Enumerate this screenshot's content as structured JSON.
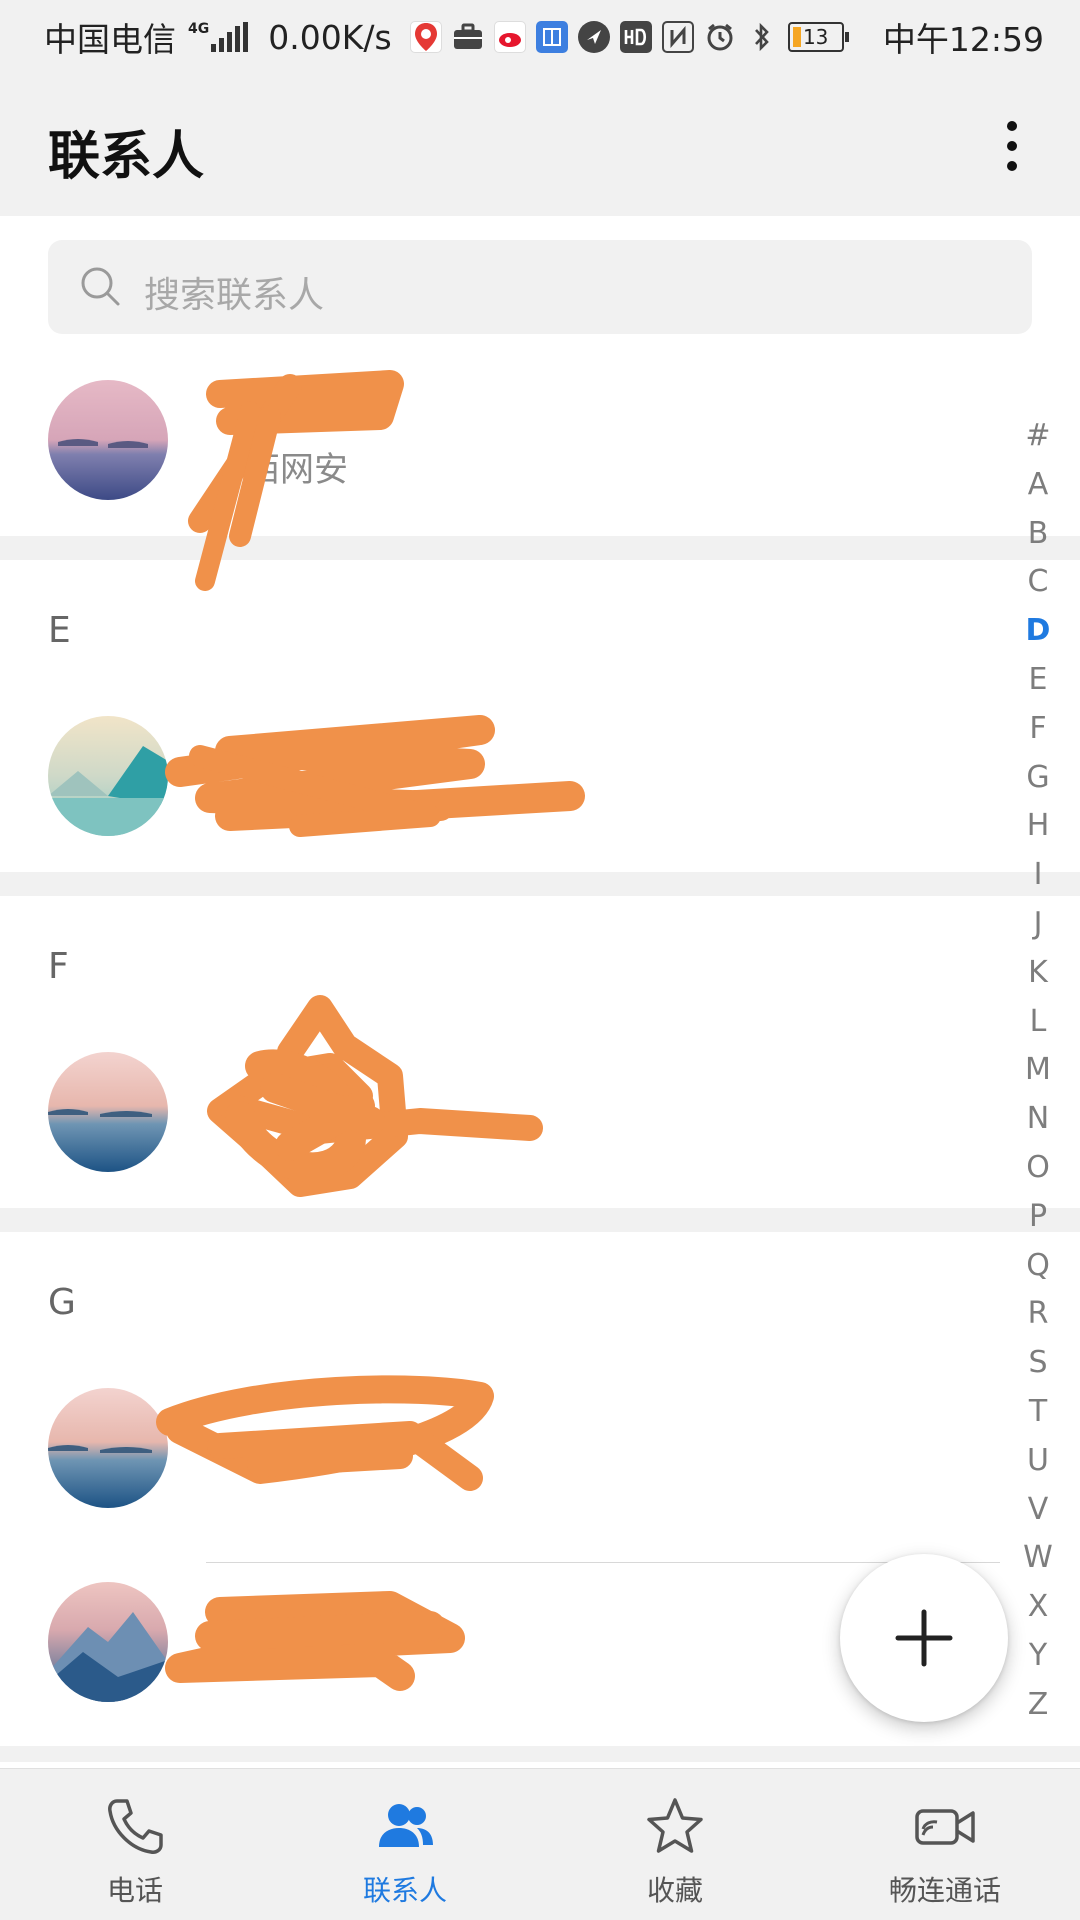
{
  "status_bar": {
    "carrier": "中国电信",
    "network": "4G",
    "speed": "0.00K/s",
    "battery": "13",
    "time": "中午12:59",
    "icons": [
      "baidu-map-icon",
      "briefcase-icon",
      "sina-icon",
      "tieba-icon",
      "bird-app-icon",
      "hd-icon",
      "nfc-icon",
      "alarm-icon",
      "bluetooth-icon",
      "battery-icon"
    ]
  },
  "header": {
    "title": "联系人",
    "more_icon": "more-vertical-icon"
  },
  "search": {
    "placeholder": "搜索联系人",
    "icon": "search-icon"
  },
  "contacts": {
    "row1": {
      "name": "",
      "sub": "西网安",
      "redacted": true
    },
    "section_e": {
      "letter": "E",
      "row1": {
        "name": "",
        "sub": "",
        "redacted": true
      }
    },
    "section_f": {
      "letter": "F",
      "row1": {
        "name": "",
        "sub": "",
        "redacted": true
      }
    },
    "section_g": {
      "letter": "G",
      "row1": {
        "name": "",
        "sub": "",
        "redacted": true
      },
      "row2": {
        "name": "",
        "sub": "",
        "redacted": true
      }
    }
  },
  "alpha_index": {
    "letters": [
      "#",
      "A",
      "B",
      "C",
      "D",
      "E",
      "F",
      "G",
      "H",
      "I",
      "J",
      "K",
      "L",
      "M",
      "N",
      "O",
      "P",
      "Q",
      "R",
      "S",
      "T",
      "U",
      "V",
      "W",
      "X",
      "Y",
      "Z"
    ],
    "active": "D"
  },
  "fab": {
    "icon": "plus-icon"
  },
  "bottom_nav": {
    "items": [
      {
        "label": "电话",
        "icon": "phone-icon"
      },
      {
        "label": "联系人",
        "icon": "contacts-icon",
        "active": true
      },
      {
        "label": "收藏",
        "icon": "star-icon"
      },
      {
        "label": "畅连通话",
        "icon": "video-call-icon"
      }
    ]
  },
  "colors": {
    "accent": "#1f7ae0",
    "redaction": "#f0914a",
    "background": "#f1f1f1"
  }
}
